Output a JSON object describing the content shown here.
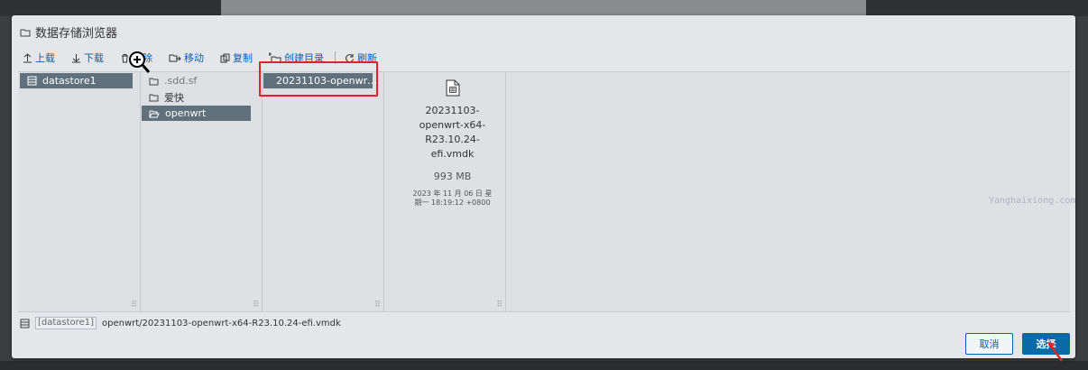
{
  "dialog": {
    "title": "数据存储浏览器"
  },
  "toolbar": {
    "upload": "上载",
    "download": "下载",
    "delete": "删除",
    "move": "移动",
    "copy": "复制",
    "mkdir": "创建目录",
    "refresh": "刷新"
  },
  "datastores": [
    {
      "label": "datastore1",
      "selected": true
    }
  ],
  "folders": [
    {
      "label": ".sdd.sf",
      "selected": false
    },
    {
      "label": "爱快",
      "selected": false
    },
    {
      "label": "openwrt",
      "selected": true
    }
  ],
  "files": [
    {
      "label": "20231103-openwr…",
      "selected": true
    }
  ],
  "detail": {
    "icon": "vmdk-file-icon",
    "name": "20231103-openwrt-x64-R23.10.24-efi.vmdk",
    "size": "993 MB",
    "modified": "2023 年 11 月 06 日 星期一 18:19:12 +0800"
  },
  "watermark": "Yanghaixiong.com",
  "path": {
    "datastore": "[datastore1]",
    "rest": "openwrt/20231103-openwrt-x64-R23.10.24-efi.vmdk"
  },
  "buttons": {
    "cancel": "取消",
    "select": "选择"
  },
  "colors": {
    "accent": "#0b5ea8",
    "selection": "#60707c",
    "highlight": "#d9262a"
  }
}
